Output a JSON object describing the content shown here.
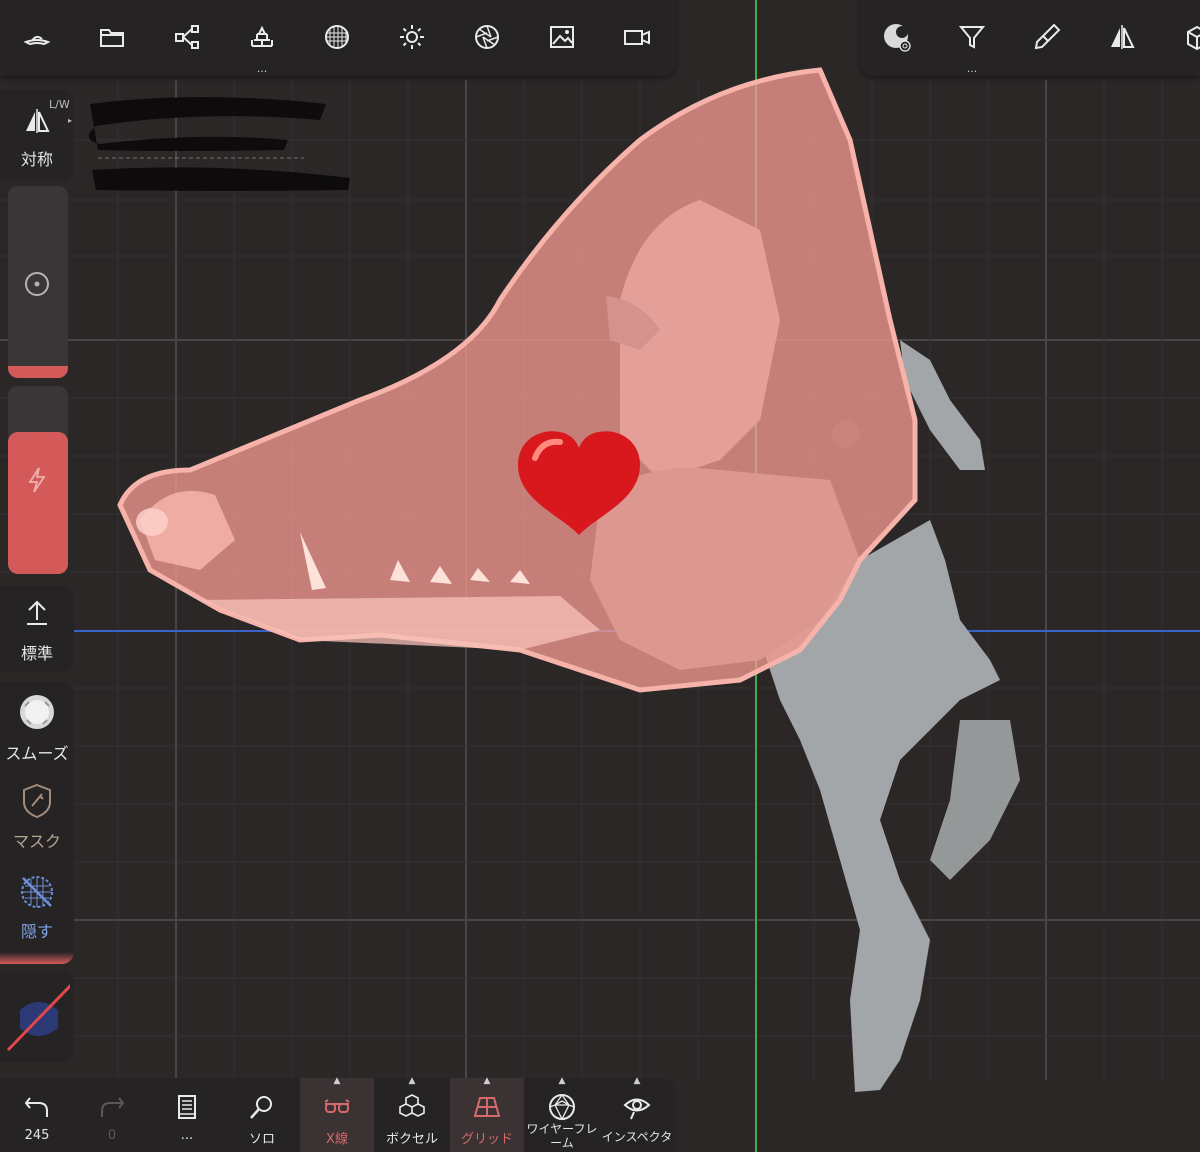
{
  "topbar_left": {
    "items": [
      {
        "icon": "hat-icon"
      },
      {
        "icon": "folder-icon"
      },
      {
        "icon": "scene-tree-icon"
      },
      {
        "icon": "bricks-icon",
        "more": "..."
      },
      {
        "icon": "topology-sphere-icon"
      },
      {
        "icon": "sun-icon"
      },
      {
        "icon": "aperture-icon"
      },
      {
        "icon": "image-icon"
      },
      {
        "icon": "video-camera-icon"
      }
    ]
  },
  "topbar_right": {
    "items": [
      {
        "icon": "material-sphere-icon"
      },
      {
        "icon": "filter-icon",
        "more": "..."
      },
      {
        "icon": "brush-icon"
      },
      {
        "icon": "symmetry-icon"
      },
      {
        "icon": "cube-icon"
      }
    ]
  },
  "sidebar": {
    "symmetry_label": "対称",
    "symmetry_mode": "L/W",
    "standard_label": "標準",
    "smooth_label": "スムーズ",
    "mask_label": "マスク",
    "hide_label": "隠す"
  },
  "bottombar": {
    "undo_count": "245",
    "redo_count": "0",
    "history_more": "...",
    "solo_label": "ソロ",
    "xray_label": "X線",
    "voxel_label": "ボクセル",
    "grid_label": "グリッド",
    "wireframe_label": "ワイヤーフレーム",
    "inspector_label": "インスペクタ"
  },
  "colors": {
    "accent_red": "#d45a5a",
    "mesh_pink": "#f4a39a",
    "mesh_grey": "#9ea1a4",
    "axis_green": "#3fae4a",
    "axis_blue": "#3a63c9",
    "heart_red": "#d8181c"
  }
}
